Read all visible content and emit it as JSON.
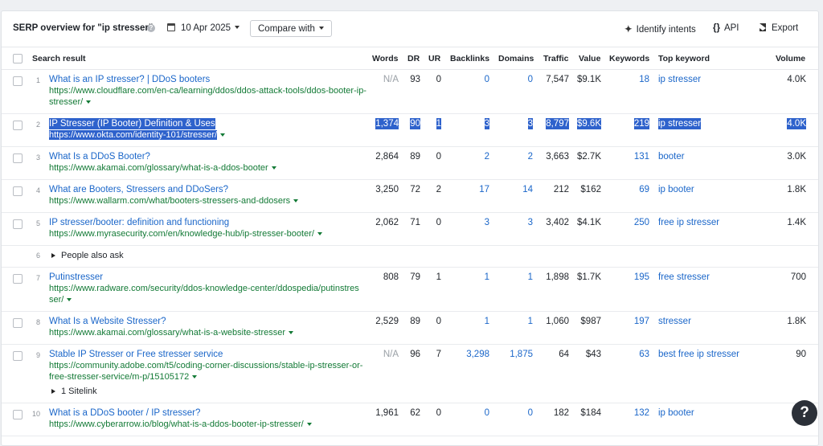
{
  "header": {
    "title": "SERP overview for \"ip stresser\"",
    "date": "10 Apr 2025",
    "compare_label": "Compare with",
    "identify_label": "Identify intents",
    "api_label": "API",
    "export_label": "Export"
  },
  "columns": {
    "result": "Search result",
    "words": "Words",
    "dr": "DR",
    "ur": "UR",
    "backlinks": "Backlinks",
    "domains": "Domains",
    "traffic": "Traffic",
    "value": "Value",
    "keywords": "Keywords",
    "top_keyword": "Top keyword",
    "volume": "Volume"
  },
  "rows": [
    {
      "pos": "1",
      "title": "What is an IP stresser? | DDoS booters",
      "url": "https://www.cloudflare.com/en-ca/learning/ddos/ddos-attack-tools/ddos-booter-ip-stresser/",
      "words": "N/A",
      "dr": "93",
      "ur": "0",
      "backlinks": "0",
      "domains": "0",
      "traffic": "7,547",
      "value": "$9.1K",
      "keywords": "18",
      "top_keyword": "ip stresser",
      "volume": "4.0K"
    },
    {
      "pos": "2",
      "title": "IP Stresser (IP Booter) Definition & Uses",
      "url": "https://www.okta.com/identity-101/stresser/",
      "words": "1,374",
      "dr": "90",
      "ur": "1",
      "backlinks": "3",
      "domains": "3",
      "traffic": "8,797",
      "value": "$9.6K",
      "keywords": "219",
      "top_keyword": "ip stresser",
      "volume": "4.0K"
    },
    {
      "pos": "3",
      "title": "What Is a DDoS Booter?",
      "url": "https://www.akamai.com/glossary/what-is-a-ddos-booter",
      "words": "2,864",
      "dr": "89",
      "ur": "0",
      "backlinks": "2",
      "domains": "2",
      "traffic": "3,663",
      "value": "$2.7K",
      "keywords": "131",
      "top_keyword": "booter",
      "volume": "3.0K"
    },
    {
      "pos": "4",
      "title": "What are Booters, Stressers and DDoSers?",
      "url": "https://www.wallarm.com/what/booters-stressers-and-ddosers",
      "words": "3,250",
      "dr": "72",
      "ur": "2",
      "backlinks": "17",
      "domains": "14",
      "traffic": "212",
      "value": "$162",
      "keywords": "69",
      "top_keyword": "ip booter",
      "volume": "1.8K"
    },
    {
      "pos": "5",
      "title": "IP stresser/booter: definition and functioning",
      "url": "https://www.myrasecurity.com/en/knowledge-hub/ip-stresser-booter/",
      "words": "2,062",
      "dr": "71",
      "ur": "0",
      "backlinks": "3",
      "domains": "3",
      "traffic": "3,402",
      "value": "$4.1K",
      "keywords": "250",
      "top_keyword": "free ip stresser",
      "volume": "1.4K"
    },
    {
      "pos": "6",
      "label": "People also ask"
    },
    {
      "pos": "7",
      "title": "Putinstresser",
      "url": "https://www.radware.com/security/ddos-knowledge-center/ddospedia/putinstresser/",
      "words": "808",
      "dr": "79",
      "ur": "1",
      "backlinks": "1",
      "domains": "1",
      "traffic": "1,898",
      "value": "$1.7K",
      "keywords": "195",
      "top_keyword": "free stresser",
      "volume": "700"
    },
    {
      "pos": "8",
      "title": "What Is a Website Stresser?",
      "url": "https://www.akamai.com/glossary/what-is-a-website-stresser",
      "words": "2,529",
      "dr": "89",
      "ur": "0",
      "backlinks": "1",
      "domains": "1",
      "traffic": "1,060",
      "value": "$987",
      "keywords": "197",
      "top_keyword": "stresser",
      "volume": "1.8K"
    },
    {
      "pos": "9",
      "title": "Stable IP Stresser or Free stresser service",
      "url": "https://community.adobe.com/t5/coding-corner-discussions/stable-ip-stresser-or-free-stresser-service/m-p/15105172",
      "words": "N/A",
      "dr": "96",
      "ur": "7",
      "backlinks": "3,298",
      "domains": "1,875",
      "traffic": "64",
      "value": "$43",
      "keywords": "63",
      "top_keyword": "best free ip stresser",
      "volume": "90",
      "sitelink": "1 Sitelink"
    },
    {
      "pos": "10",
      "title": "What is a DDoS booter / IP stresser?",
      "url": "https://www.cyberarrow.io/blog/what-is-a-ddos-booter-ip-stresser/",
      "words": "1,961",
      "dr": "62",
      "ur": "0",
      "backlinks": "0",
      "domains": "0",
      "traffic": "182",
      "value": "$184",
      "keywords": "132",
      "top_keyword": "ip booter",
      "volume": "1"
    }
  ],
  "help_label": "?"
}
